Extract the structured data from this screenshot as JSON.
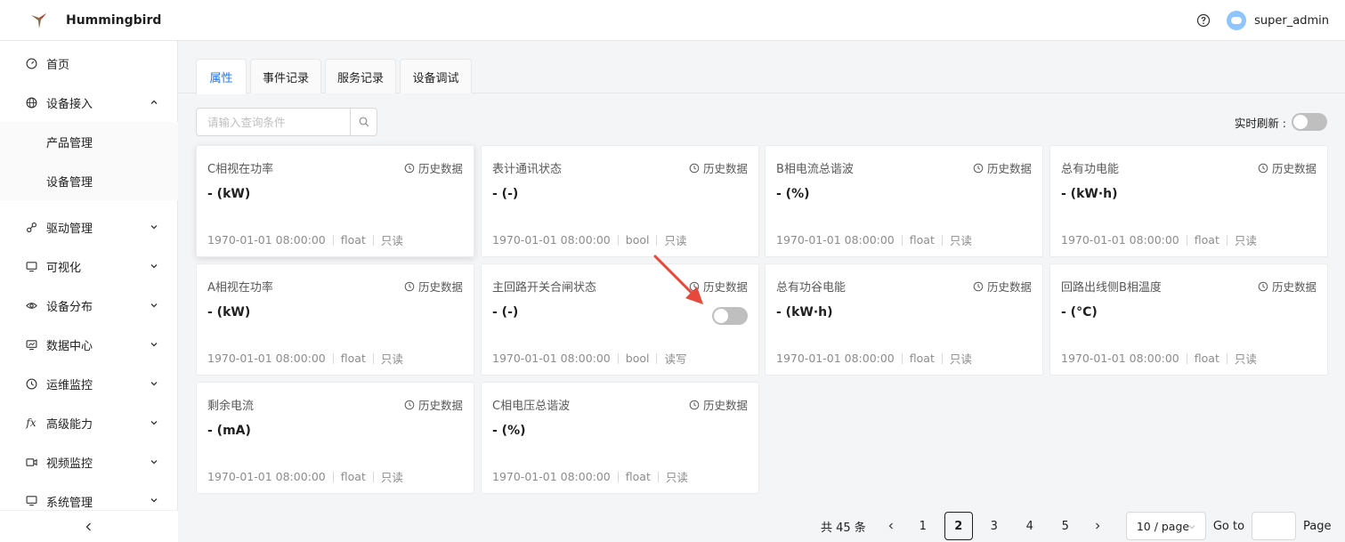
{
  "app": {
    "title": "Hummingbird",
    "username": "super_admin"
  },
  "icons": {
    "logo": "hummingbird-logo",
    "help": "question-circle-icon",
    "avatar": "user-avatar"
  },
  "sidebar": {
    "items": [
      {
        "label": "首页",
        "icon": "dashboard-icon"
      },
      {
        "label": "设备接入",
        "icon": "globe-icon",
        "expanded": true,
        "children": [
          {
            "label": "产品管理"
          },
          {
            "label": "设备管理"
          }
        ]
      },
      {
        "label": "驱动管理",
        "icon": "link-icon"
      },
      {
        "label": "可视化",
        "icon": "monitor-icon"
      },
      {
        "label": "设备分布",
        "icon": "eye-icon"
      },
      {
        "label": "数据中心",
        "icon": "screen-data-icon"
      },
      {
        "label": "运维监控",
        "icon": "clock-icon"
      },
      {
        "label": "高级能力",
        "icon": "fx-icon"
      },
      {
        "label": "视频监控",
        "icon": "video-icon"
      },
      {
        "label": "系统管理",
        "icon": "desktop-icon"
      }
    ]
  },
  "tabs": [
    "属性",
    "事件记录",
    "服务记录",
    "设备调试"
  ],
  "search": {
    "placeholder": "请输入查询条件"
  },
  "refresh": {
    "label": "实时刷新 :",
    "enabled": false
  },
  "history_label": "历史数据",
  "cards": [
    {
      "title": "C相视在功率",
      "value": "- (kW)",
      "time": "1970-01-01 08:00:00",
      "type": "float",
      "access": "只读"
    },
    {
      "title": "表计通讯状态",
      "value": "- (-)",
      "time": "1970-01-01 08:00:00",
      "type": "bool",
      "access": "只读"
    },
    {
      "title": "B相电流总谐波",
      "value": "- (%)",
      "time": "1970-01-01 08:00:00",
      "type": "float",
      "access": "只读"
    },
    {
      "title": "总有功电能",
      "value": "- (kW·h)",
      "time": "1970-01-01 08:00:00",
      "type": "float",
      "access": "只读"
    },
    {
      "title": "A相视在功率",
      "value": "- (kW)",
      "time": "1970-01-01 08:00:00",
      "type": "float",
      "access": "只读"
    },
    {
      "title": "主回路开关合闸状态",
      "value": "- (-)",
      "time": "1970-01-01 08:00:00",
      "type": "bool",
      "access": "读写",
      "toggle": false
    },
    {
      "title": "总有功谷电能",
      "value": "- (kW·h)",
      "time": "1970-01-01 08:00:00",
      "type": "float",
      "access": "只读"
    },
    {
      "title": "回路出线侧B相温度",
      "value": "- (°C)",
      "time": "1970-01-01 08:00:00",
      "type": "float",
      "access": "只读"
    },
    {
      "title": "剩余电流",
      "value": "- (mA)",
      "time": "1970-01-01 08:00:00",
      "type": "float",
      "access": "只读"
    },
    {
      "title": "C相电压总谐波",
      "value": "- (%)",
      "time": "1970-01-01 08:00:00",
      "type": "float",
      "access": "只读"
    }
  ],
  "pagination": {
    "total": "共 45 条",
    "pages": [
      "1",
      "2",
      "3",
      "4",
      "5"
    ],
    "current": "2",
    "page_size": "10 / page",
    "goto_label": "Go to",
    "page_label": "Page"
  },
  "colors": {
    "accent": "#1677ff",
    "annotation_arrow": "#e8483b"
  }
}
